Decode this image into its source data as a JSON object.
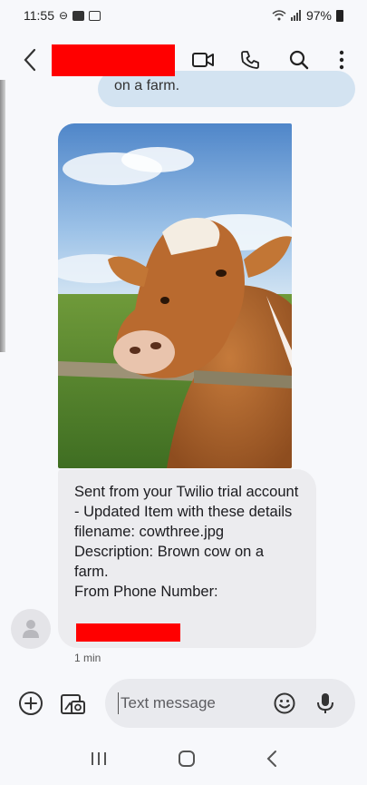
{
  "status_bar": {
    "time": "11:55",
    "battery": "97%"
  },
  "header": {
    "back_icon": "chevron-left-icon",
    "video_icon": "video-call-icon",
    "phone_icon": "phone-icon",
    "search_icon": "search-icon",
    "more_icon": "more-vert-icon"
  },
  "conversation": {
    "previous_bubble_text": "on a farm.",
    "image_alt": "Brown cow on a farm",
    "message_text": "Sent from your Twilio trial account - Updated Item with these details\n filename: cowthree.jpg\n Description: Brown cow on a farm.\n From Phone Number:",
    "timestamp": "1 min"
  },
  "composer": {
    "placeholder": "Text message"
  },
  "colors": {
    "redaction": "#ff0000",
    "outgoing_bubble": "#d3e3f1",
    "incoming_bubble": "#ececef",
    "background": "#f7f8fb"
  }
}
